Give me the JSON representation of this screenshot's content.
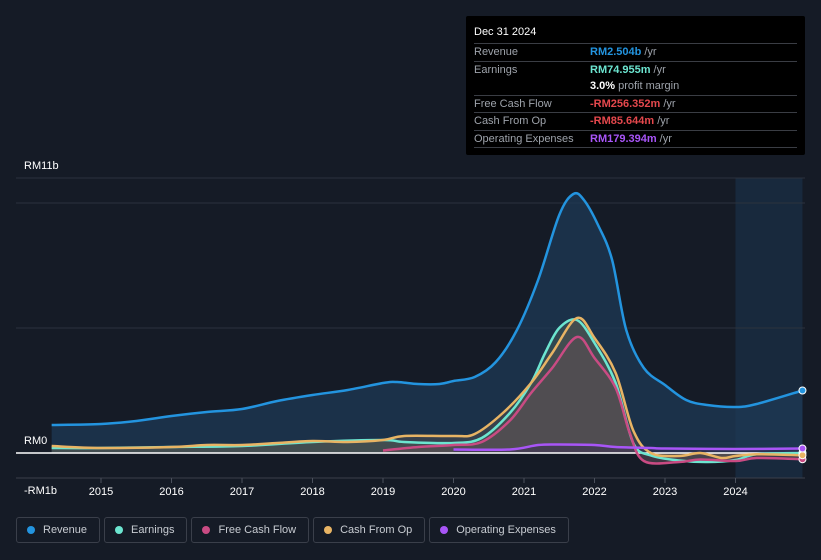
{
  "tooltip": {
    "date": "Dec 31 2024",
    "rows": [
      {
        "label": "Revenue",
        "value": "RM2.504b",
        "unit": "/yr",
        "color": "#2394df"
      },
      {
        "label": "Earnings",
        "value": "RM74.955m",
        "unit": "/yr",
        "color": "#6ce5d0"
      },
      {
        "label": "",
        "value": "3.0%",
        "unit": "profit margin",
        "color": "#ffffff"
      },
      {
        "label": "Free Cash Flow",
        "value": "-RM256.352m",
        "unit": "/yr",
        "color": "#e5484d"
      },
      {
        "label": "Cash From Op",
        "value": "-RM85.644m",
        "unit": "/yr",
        "color": "#e5484d"
      },
      {
        "label": "Operating Expenses",
        "value": "RM179.394m",
        "unit": "/yr",
        "color": "#a855f7"
      }
    ]
  },
  "legend": [
    {
      "label": "Revenue",
      "color": "#2394df"
    },
    {
      "label": "Earnings",
      "color": "#6ce5d0"
    },
    {
      "label": "Free Cash Flow",
      "color": "#c94b83"
    },
    {
      "label": "Cash From Op",
      "color": "#e8b464"
    },
    {
      "label": "Operating Expenses",
      "color": "#a855f7"
    }
  ],
  "chart_data": {
    "type": "area",
    "title": "",
    "xlabel": "",
    "ylabel": "",
    "y_unit": "RM billions",
    "ylim": [
      -1,
      11
    ],
    "xlim": [
      2014.3,
      2024.95
    ],
    "y_tick_labels": [
      {
        "value": 11,
        "label": "RM11b"
      },
      {
        "value": 0,
        "label": "RM0"
      },
      {
        "value": -1,
        "label": "-RM1b"
      }
    ],
    "gridlines": [
      11,
      10,
      5,
      0,
      -1
    ],
    "x_ticks": [
      2015,
      2016,
      2017,
      2018,
      2019,
      2020,
      2021,
      2022,
      2023,
      2024
    ],
    "highlight_range": [
      2024,
      2024.95
    ],
    "series": [
      {
        "name": "Revenue",
        "color": "#2394df",
        "points": [
          [
            2014.3,
            1.12
          ],
          [
            2015,
            1.16
          ],
          [
            2015.5,
            1.28
          ],
          [
            2016,
            1.48
          ],
          [
            2016.5,
            1.64
          ],
          [
            2017,
            1.76
          ],
          [
            2017.5,
            2.08
          ],
          [
            2018,
            2.32
          ],
          [
            2018.5,
            2.52
          ],
          [
            2019,
            2.8
          ],
          [
            2019.2,
            2.84
          ],
          [
            2019.5,
            2.76
          ],
          [
            2019.8,
            2.76
          ],
          [
            2020,
            2.88
          ],
          [
            2020.3,
            3.04
          ],
          [
            2020.6,
            3.64
          ],
          [
            2020.9,
            4.92
          ],
          [
            2021.2,
            6.92
          ],
          [
            2021.5,
            9.52
          ],
          [
            2021.7,
            10.36
          ],
          [
            2021.85,
            10.12
          ],
          [
            2022.05,
            9.12
          ],
          [
            2022.25,
            7.72
          ],
          [
            2022.45,
            4.92
          ],
          [
            2022.7,
            3.4
          ],
          [
            2023,
            2.72
          ],
          [
            2023.3,
            2.12
          ],
          [
            2023.6,
            1.92
          ],
          [
            2024,
            1.84
          ],
          [
            2024.3,
            1.96
          ],
          [
            2024.95,
            2.5
          ]
        ]
      },
      {
        "name": "Earnings",
        "color": "#6ce5d0",
        "points": [
          [
            2014.3,
            0.2
          ],
          [
            2015,
            0.2
          ],
          [
            2016,
            0.24
          ],
          [
            2017,
            0.28
          ],
          [
            2018,
            0.44
          ],
          [
            2019,
            0.52
          ],
          [
            2019.3,
            0.44
          ],
          [
            2020,
            0.4
          ],
          [
            2020.4,
            0.6
          ],
          [
            2020.8,
            1.6
          ],
          [
            2021.1,
            2.8
          ],
          [
            2021.3,
            4.0
          ],
          [
            2021.5,
            5.0
          ],
          [
            2021.75,
            5.32
          ],
          [
            2022,
            4.4
          ],
          [
            2022.3,
            2.8
          ],
          [
            2022.55,
            0.4
          ],
          [
            2022.8,
            -0.1
          ],
          [
            2023.2,
            -0.3
          ],
          [
            2023.6,
            -0.36
          ],
          [
            2024,
            -0.28
          ],
          [
            2024.3,
            -0.05
          ],
          [
            2024.95,
            0.0
          ]
        ]
      },
      {
        "name": "Free Cash Flow",
        "color": "#c94b83",
        "points": [
          [
            2019,
            0.1
          ],
          [
            2019.5,
            0.24
          ],
          [
            2020,
            0.32
          ],
          [
            2020.4,
            0.44
          ],
          [
            2020.8,
            1.3
          ],
          [
            2021.1,
            2.4
          ],
          [
            2021.4,
            3.4
          ],
          [
            2021.75,
            4.64
          ],
          [
            2022,
            3.8
          ],
          [
            2022.3,
            2.6
          ],
          [
            2022.5,
            0.8
          ],
          [
            2022.7,
            -0.32
          ],
          [
            2023.2,
            -0.36
          ],
          [
            2023.5,
            -0.26
          ],
          [
            2024,
            -0.32
          ],
          [
            2024.3,
            -0.2
          ],
          [
            2024.95,
            -0.25
          ]
        ]
      },
      {
        "name": "Cash From Op",
        "color": "#e8b464",
        "points": [
          [
            2014.3,
            0.28
          ],
          [
            2015,
            0.2
          ],
          [
            2016,
            0.24
          ],
          [
            2016.5,
            0.32
          ],
          [
            2017,
            0.32
          ],
          [
            2017.5,
            0.4
          ],
          [
            2018,
            0.48
          ],
          [
            2018.5,
            0.44
          ],
          [
            2019,
            0.52
          ],
          [
            2019.3,
            0.68
          ],
          [
            2020,
            0.68
          ],
          [
            2020.3,
            0.76
          ],
          [
            2020.7,
            1.6
          ],
          [
            2021.1,
            2.8
          ],
          [
            2021.4,
            4.0
          ],
          [
            2021.75,
            5.4
          ],
          [
            2022,
            4.6
          ],
          [
            2022.3,
            3.2
          ],
          [
            2022.55,
            0.9
          ],
          [
            2022.8,
            0.0
          ],
          [
            2023.2,
            -0.12
          ],
          [
            2023.5,
            0.0
          ],
          [
            2023.8,
            -0.2
          ],
          [
            2024,
            -0.12
          ],
          [
            2024.3,
            -0.05
          ],
          [
            2024.95,
            -0.09
          ]
        ]
      },
      {
        "name": "Operating Expenses",
        "color": "#a855f7",
        "points": [
          [
            2020,
            0.14
          ],
          [
            2020.8,
            0.14
          ],
          [
            2021.2,
            0.32
          ],
          [
            2021.5,
            0.34
          ],
          [
            2022,
            0.32
          ],
          [
            2022.3,
            0.24
          ],
          [
            2022.8,
            0.2
          ],
          [
            2023,
            0.18
          ],
          [
            2024,
            0.16
          ],
          [
            2024.95,
            0.18
          ]
        ]
      }
    ]
  }
}
